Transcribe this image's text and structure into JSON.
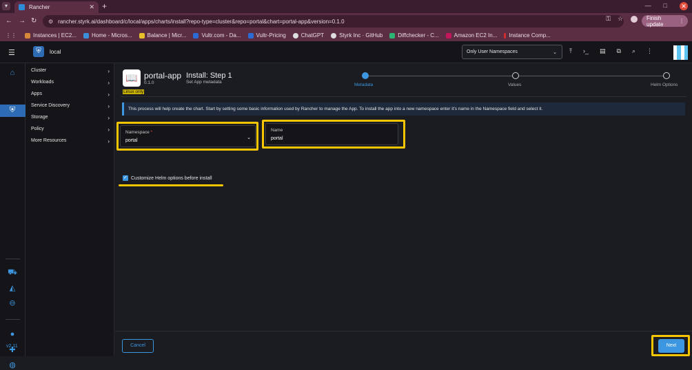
{
  "browser": {
    "tab_title": "Rancher",
    "tab_close": "✕",
    "new_tab": "+",
    "url": "rancher.styrk.ai/dashboard/c/local/apps/charts/install?repo-type=cluster&repo=portal&chart=portal-app&version=0.1.0",
    "finish_update": "Finish update",
    "bookmarks": [
      {
        "label": "Instances | EC2...",
        "color": "#e07b2e"
      },
      {
        "label": "Home - Micros...",
        "color": "#3a8fd8"
      },
      {
        "label": "Balance | Micr...",
        "color": "#e8c02a"
      },
      {
        "label": "Vultr.com - Da...",
        "color": "#2c6bd6"
      },
      {
        "label": "Vultr-Pricing",
        "color": "#2c6bd6"
      },
      {
        "label": "ChatGPT",
        "color": "#dddddd"
      },
      {
        "label": "Styrk Inc · GitHub",
        "color": "#dddddd"
      },
      {
        "label": "Diffchecker - C...",
        "color": "#2bb673"
      },
      {
        "label": "Amazon EC2 In...",
        "color": "#c2185b"
      },
      {
        "label": "Instance Comp...",
        "color": "#d12f2f"
      }
    ]
  },
  "topbar": {
    "cluster_name": "local",
    "namespace_filter": "Only User Namespaces"
  },
  "sidebar": {
    "items": [
      {
        "label": "Cluster"
      },
      {
        "label": "Workloads"
      },
      {
        "label": "Apps"
      },
      {
        "label": "Service Discovery"
      },
      {
        "label": "Storage"
      },
      {
        "label": "Policy"
      },
      {
        "label": "More Resources"
      }
    ],
    "version": "v2.11"
  },
  "chart": {
    "name": "portal-app",
    "version": "0.1.0",
    "os_badge": "Linux only"
  },
  "wizard": {
    "title": "Install: Step 1",
    "subtitle": "Set App metadata",
    "steps": [
      {
        "label": "Metadata",
        "active": true
      },
      {
        "label": "Values",
        "active": false
      },
      {
        "label": "Helm Options",
        "active": false
      }
    ],
    "info_text": "This process will help create the chart. Start by setting some basic information used by Rancher to manage the App. To install the app into a new namespace enter it's name in the Namespace field and select it."
  },
  "form": {
    "namespace_label": "Namespace",
    "namespace_required": "*",
    "namespace_value": "portal",
    "name_label": "Name",
    "name_value": "portal",
    "customize_label": "Customize Helm options before install",
    "customize_checked": true
  },
  "footer": {
    "cancel_label": "Cancel",
    "next_label": "Next"
  },
  "colors": {
    "accent": "#3d97e0",
    "highlight": "#f6c600",
    "browser_chrome": "#5b2e44"
  }
}
